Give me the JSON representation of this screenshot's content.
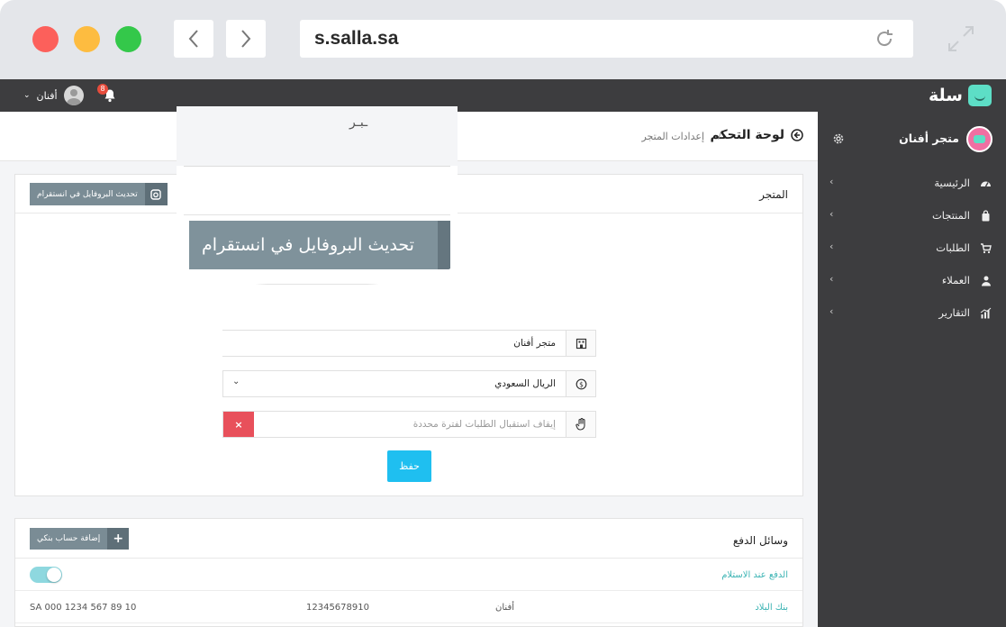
{
  "browser": {
    "url": "s.salla.sa"
  },
  "topbar": {
    "brand": "سلة",
    "user_name": "أفنان",
    "notification_count": "8"
  },
  "sidebar": {
    "store_name": "متجر أفنان",
    "items": [
      {
        "label": "الرئيسية",
        "icon": "dashboard-icon"
      },
      {
        "label": "المنتجات",
        "icon": "products-bag-icon"
      },
      {
        "label": "الطلبات",
        "icon": "cart-icon"
      },
      {
        "label": "العملاء",
        "icon": "customers-icon"
      },
      {
        "label": "التقارير",
        "icon": "reports-chart-icon"
      }
    ]
  },
  "breadcrumb": {
    "home": "لوحة التحكم",
    "separator": "/",
    "current": "إعدادات المتجر"
  },
  "store_card": {
    "title": "المتجر",
    "instagram_button": "تحديث البروفايل في انستقرام",
    "store_name_value": "متجر أفنان",
    "currency_value": "الريال السعودي",
    "pause_orders_placeholder": "إيقاف استقبال الطلبات لفترة محددة",
    "clear_label": "×",
    "save_label": "حفظ"
  },
  "magnifier": {
    "scribble": "ـبـر",
    "button_text": "تحديث البروفايل في انستقرام"
  },
  "payment_card": {
    "title": "وسائل الدفع",
    "add_bank_button": "إضافة حساب بنكي",
    "add_icon": "+",
    "cash_on_delivery": "الدفع عند الاستلام",
    "cod_enabled": true,
    "bank_row": {
      "bank_name": "بنك البلاد",
      "holder": "أفنان",
      "account_number": "12345678910",
      "iban": "SA 000 1234 567 89 10"
    }
  },
  "colors": {
    "accent": "#1fbff0",
    "brand": "#5ddec6",
    "sidebar_bg": "#3d3d3f",
    "danger": "#e8505b"
  }
}
